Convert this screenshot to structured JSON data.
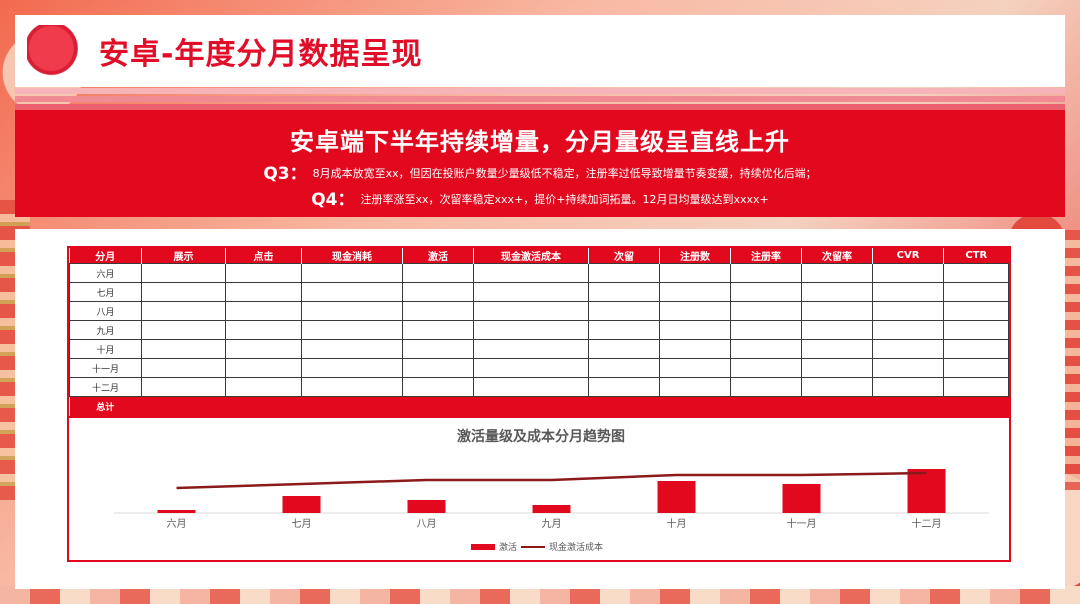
{
  "header": {
    "title": "安卓-年度分月数据呈现"
  },
  "banner": {
    "title": "安卓端下半年持续增量，分月量级呈直线上升",
    "q3_label": "Q3：",
    "q3_text": "8月成本放宽至xx，但因在投账户数量少量级低不稳定，注册率过低导致增量节奏变缓，持续优化后端；",
    "q4_label": "Q4：",
    "q4_text": "注册率涨至xx，次留率稳定xxx+，提价+持续加词拓量。12月日均量级达到xxxx+"
  },
  "table": {
    "headers": [
      "分月",
      "展示",
      "点击",
      "现金消耗",
      "激活",
      "现金激活成本",
      "次留",
      "注册数",
      "注册率",
      "次留率",
      "CVR",
      "CTR"
    ],
    "rows": [
      "六月",
      "七月",
      "八月",
      "九月",
      "十月",
      "十一月",
      "十二月"
    ],
    "total_label": "总计"
  },
  "colors": {
    "primary_red": "#e2091f",
    "line_color": "#8b1a1a"
  },
  "chart_data": {
    "type": "bar",
    "title": "激活量级及成本分月趋势图",
    "categories": [
      "六月",
      "七月",
      "八月",
      "九月",
      "十月",
      "十一月",
      "十二月"
    ],
    "series": [
      {
        "name": "激活",
        "type": "bar",
        "values": [
          3,
          17,
          13,
          8,
          32,
          29,
          44
        ]
      },
      {
        "name": "现金激活成本",
        "type": "line",
        "values": [
          25,
          29,
          33,
          33,
          38,
          38,
          40
        ]
      }
    ],
    "ylim": [
      0,
      50
    ],
    "legend": "bottom"
  }
}
